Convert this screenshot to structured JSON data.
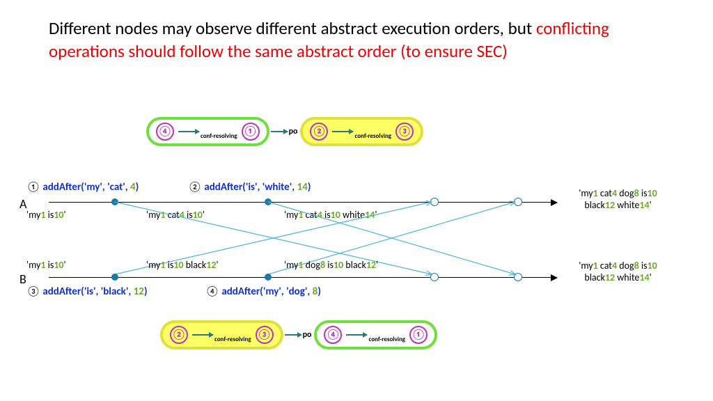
{
  "title_black": "Different nodes may observe different abstract execution orders, but ",
  "title_red": "conflicting operations should follow the same abstract order (to ensure SEC)",
  "po_label": "po",
  "conf_label": "conf-resolving",
  "circ": {
    "1": "①",
    "2": "②",
    "3": "③",
    "4": "④"
  },
  "timelines": {
    "A": {
      "label": "A",
      "final": "'my1 cat4 dog8 is10\nblack12 white14'",
      "ops": [
        {
          "n": "①",
          "call": "addAfter('my', 'cat', ",
          "g": "4",
          "tail": ")"
        },
        {
          "n": "②",
          "call": "addAfter('is', 'white', ",
          "g": "14",
          "tail": ")"
        }
      ],
      "states": [
        "'my1 is10'",
        "'my1 cat4 is10'",
        "'my1 cat4 is10 white14'"
      ]
    },
    "B": {
      "label": "B",
      "final": "'my1 cat4 dog8 is10\nblack12 white14'",
      "ops": [
        {
          "n": "③",
          "call": "addAfter('is', 'black', ",
          "g": "12",
          "tail": ")"
        },
        {
          "n": "④",
          "call": "addAfter('my', 'dog', ",
          "g": "8",
          "tail": ")"
        }
      ],
      "states": [
        "'my1 is10'",
        "'my1 is10 black12'",
        "'my1 dog8 is10 black12'"
      ]
    }
  },
  "top_order": [
    "4",
    "1",
    "2",
    "3"
  ],
  "bottom_order": [
    "2",
    "3",
    "4",
    "1"
  ]
}
